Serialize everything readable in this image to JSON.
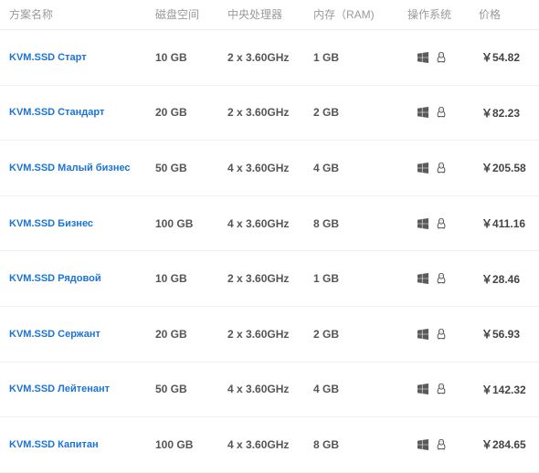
{
  "columns": {
    "plan": "方案名称",
    "disk": "磁盘空间",
    "cpu": "中央处理器",
    "ram": "内存（RAM)",
    "os": "操作系统",
    "price": "价格"
  },
  "plans": [
    {
      "name": "KVM.SSD Старт",
      "disk": "10 GB",
      "cpu": "2 x 3.60GHz",
      "ram": "1 GB",
      "os": [
        "windows-icon",
        "linux-icon"
      ],
      "price": "￥54.82"
    },
    {
      "name": "KVM.SSD Стандарт",
      "disk": "20 GB",
      "cpu": "2 x 3.60GHz",
      "ram": "2 GB",
      "os": [
        "windows-icon",
        "linux-icon"
      ],
      "price": "￥82.23"
    },
    {
      "name": "KVM.SSD Малый бизнес",
      "disk": "50 GB",
      "cpu": "4 x 3.60GHz",
      "ram": "4 GB",
      "os": [
        "windows-icon",
        "linux-icon"
      ],
      "price": "￥205.58"
    },
    {
      "name": "KVM.SSD Бизнес",
      "disk": "100 GB",
      "cpu": "4 x 3.60GHz",
      "ram": "8 GB",
      "os": [
        "windows-icon",
        "linux-icon"
      ],
      "price": "￥411.16"
    },
    {
      "name": "KVM.SSD Рядовой",
      "disk": "10 GB",
      "cpu": "2 x 3.60GHz",
      "ram": "1 GB",
      "os": [
        "windows-icon",
        "linux-icon"
      ],
      "price": "￥28.46"
    },
    {
      "name": "KVM.SSD Сержант",
      "disk": "20 GB",
      "cpu": "2 x 3.60GHz",
      "ram": "2 GB",
      "os": [
        "windows-icon",
        "linux-icon"
      ],
      "price": "￥56.93"
    },
    {
      "name": "KVM.SSD Лейтенант",
      "disk": "50 GB",
      "cpu": "4 x 3.60GHz",
      "ram": "4 GB",
      "os": [
        "windows-icon",
        "linux-icon"
      ],
      "price": "￥142.32"
    },
    {
      "name": "KVM.SSD Капитан",
      "disk": "100 GB",
      "cpu": "4 x 3.60GHz",
      "ram": "8 GB",
      "os": [
        "windows-icon",
        "linux-icon"
      ],
      "price": "￥284.65"
    }
  ],
  "colors": {
    "link": "#1a73d6",
    "header_text": "#9a9a9a",
    "icon": "#555555"
  }
}
